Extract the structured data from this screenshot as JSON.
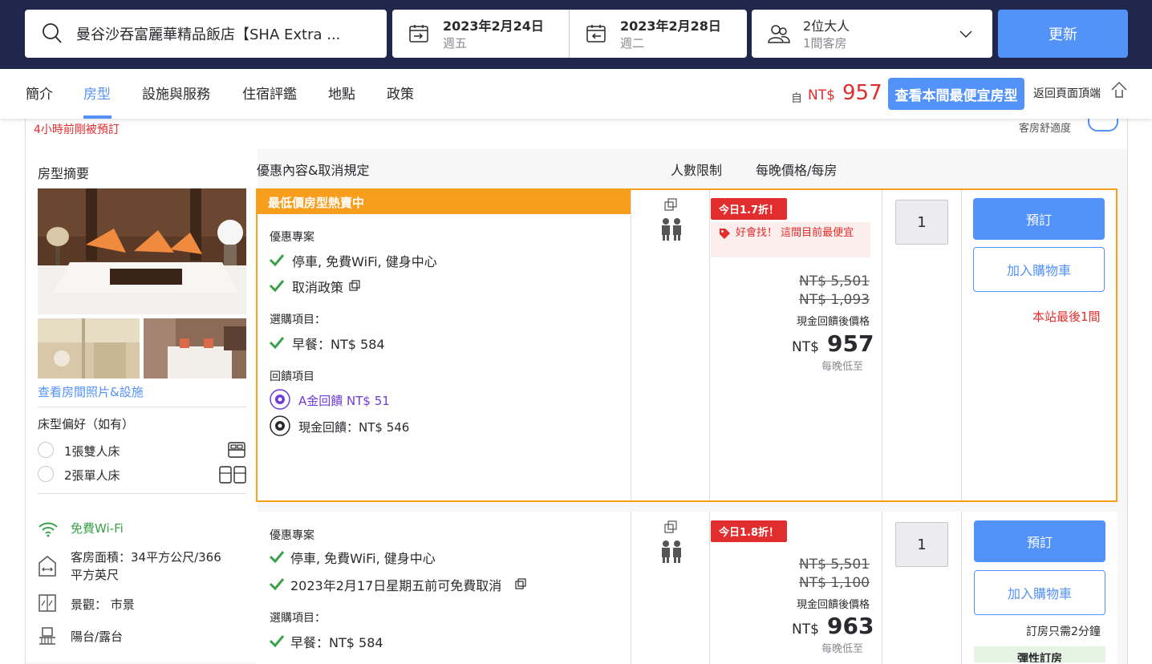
{
  "search": {
    "hotel_name": "曼谷沙吞富麗華精品飯店【SHA Extra ...",
    "checkin_date": "2023年2月24日",
    "checkin_day": "週五",
    "checkout_date": "2023年2月28日",
    "checkout_day": "週二",
    "guests": "2位大人",
    "rooms": "1間客房",
    "update_label": "更新"
  },
  "nav": {
    "tabs": [
      "簡介",
      "房型",
      "設施與服務",
      "住宿評鑑",
      "地點",
      "政策"
    ],
    "active_tab": "房型",
    "from_label": "自",
    "from_currency": "NT$",
    "from_price": "957",
    "cheapest_button": "查看本間最便宜房型",
    "back_to_top": "返回頁面頂端"
  },
  "room": {
    "recent_booking": "4小時前剛被預訂",
    "comfort_label": "客房舒適度",
    "headers": {
      "summary": "房型摘要",
      "offer": "優惠內容&取消規定",
      "occupancy": "人數限制",
      "price": "每晚價格/每房"
    },
    "photos_link": "查看房間照片&設施",
    "bed_pref_title": "床型偏好（如有）",
    "bed_options": [
      "1張雙人床",
      "2張單人床"
    ],
    "amenities": {
      "wifi": "免費Wi-Fi",
      "area": "客房面積：34平方公尺/366平方英尺",
      "area_line1": "客房面積：34平方公尺/366",
      "area_line2": "平方英尺",
      "view": "景觀： 市景",
      "balcony": "陽台/露台"
    }
  },
  "offer1": {
    "banner": "最低價房型熱賣中",
    "deal_title": "優惠專案",
    "perk1": "停車, 免費WiFi, 健身中心",
    "perk2": "取消政策",
    "options_title": "選購項目：",
    "breakfast": "早餐：NT$ 584",
    "cashback_title": "回饋項目",
    "cashback_a": "A金回饋 NT$ 51",
    "cashback_cash": "現金回饋：NT$ 546",
    "discount_badge": "今日1.7折！",
    "good_deal": "好會找！ 這間目前最便宜",
    "strike1": "NT$ 5,501",
    "strike2": "NT$ 1,093",
    "after_cashback": "現金回饋後價格",
    "currency": "NT$",
    "price": "957",
    "per_night": "每晚低至",
    "qty": "1",
    "book": "預訂",
    "cart": "加入購物車",
    "last_room": "本站最後1間"
  },
  "offer2": {
    "deal_title": "優惠專案",
    "perk1": "停車, 免費WiFi, 健身中心",
    "perk2": "2023年2月17日星期五前可免費取消",
    "options_title": "選購項目：",
    "breakfast": "早餐：NT$ 584",
    "discount_badge": "今日1.8折！",
    "strike1": "NT$ 5,501",
    "strike2": "NT$ 1,100",
    "after_cashback": "現金回饋後價格",
    "currency": "NT$",
    "price": "963",
    "per_night": "每晚低至",
    "qty": "1",
    "book": "預訂",
    "cart": "加入購物車",
    "booking_time": "訂房只需2分鐘",
    "instant": "彈性訂房"
  },
  "colors": {
    "navy": "#20274d",
    "accent_blue": "#5392f9",
    "orange": "#f89e1d",
    "red": "#e12d2d",
    "green": "#3aa14a",
    "purple": "#6f3bd8"
  }
}
